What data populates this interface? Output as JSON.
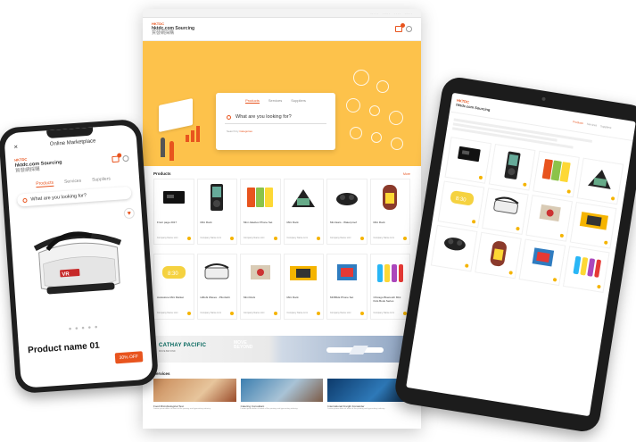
{
  "colors": {
    "accent": "#e8541e",
    "hero_bg": "#fdc24b",
    "rating": "#f5b400"
  },
  "brand": {
    "tag": "HKTDC",
    "site": "hktdc.com Sourcing",
    "cn": "貿發網採購"
  },
  "desktop": {
    "search_tabs": [
      "Products",
      "Services",
      "Suppliers"
    ],
    "search_placeholder": "What are you looking for?",
    "search_category_prefix": "Search by",
    "search_category_link": "Categories",
    "products_title": "Products",
    "services_title": "Services",
    "more": "More",
    "products": [
      {
        "name": "Front page 2017",
        "icon": "tablet-case"
      },
      {
        "name": "Mini Rock",
        "icon": "mp3-player"
      },
      {
        "name": "Mini Jukebox Phone Set",
        "icon": "retro-players"
      },
      {
        "name": "Mini Rock",
        "icon": "picture-frame"
      },
      {
        "name": "Mini Ears - Waterproof",
        "icon": "earbuds"
      },
      {
        "name": "Mini Rock",
        "icon": "jukebox"
      },
      {
        "name": "Aurastone Mini Market",
        "icon": "led-clock"
      },
      {
        "name": "HMobi Waves - Pilot Edit",
        "icon": "vr-headset"
      },
      {
        "name": "Mini Rock",
        "icon": "box-speaker"
      },
      {
        "name": "Mini Rock",
        "icon": "cube-speaker"
      },
      {
        "name": "MOBILE Phone Set",
        "icon": "blue-box"
      },
      {
        "name": "Chicago Bluetooth Mini Kids Book Series",
        "icon": "color-bottles"
      }
    ],
    "product_footer": "Company Name Limi",
    "banner": {
      "airline": "CATHAY PACIFIC",
      "airline_sub": "MOVE BEYOND",
      "slogan_line1": "MOVE",
      "slogan_line2": "BEYOND"
    },
    "services": [
      {
        "name": "Food Microbiological Test",
        "desc": "Lorem ipsum dolor sit amet of the printing and typesetting industry."
      },
      {
        "name": "Catering Consultant",
        "desc": "Lorem ipsum dolor sit amet of the printing and typesetting industry."
      },
      {
        "name": "International Freight Forwarder",
        "desc": "Lorem ipsum dolor sit amet of the printing and typesetting industry."
      }
    ]
  },
  "phone": {
    "title": "Online Marketplace",
    "tabs": [
      "Products",
      "Services",
      "Suppliers"
    ],
    "search_placeholder": "What are you looking for?",
    "product_name": "Product name 01",
    "badge": "30% OFF",
    "pager": "● ● ● ● ●"
  },
  "tablet": {
    "tabs": [
      "Products",
      "Services",
      "Suppliers"
    ]
  }
}
